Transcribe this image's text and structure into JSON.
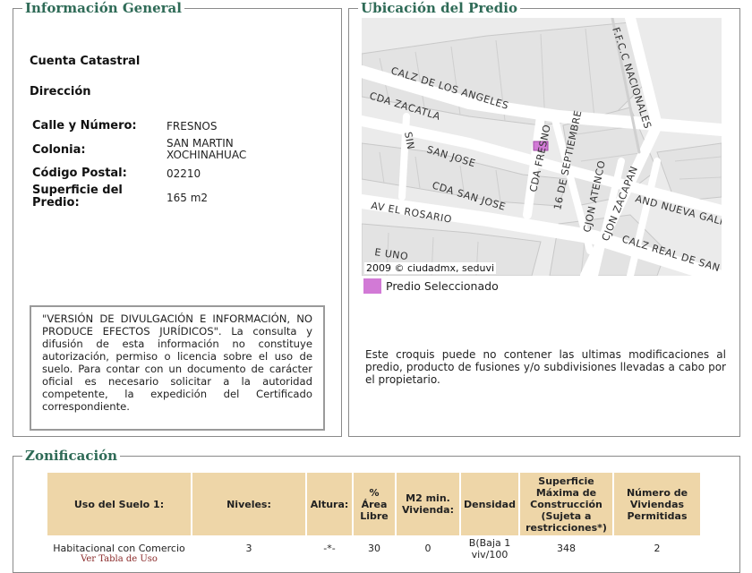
{
  "info": {
    "legend": "Información General",
    "cuenta_label": "Cuenta Catastral",
    "direccion_label": "Dirección",
    "calle_label": "Calle y Número:",
    "calle_value": "FRESNOS",
    "colonia_label": "Colonia:",
    "colonia_value": "SAN MARTIN XOCHINAHUAC",
    "cp_label": "Código Postal:",
    "cp_value": "02210",
    "superficie_label": "Superficie del Predio:",
    "superficie_value": "165 m2",
    "disclaimer": "\"VERSIÓN DE DIVULGACIÓN E INFORMACIÓN, NO PRODUCE EFECTOS JURÍDICOS\". La consulta y difusión de esta información no constituye autorización, permiso o licencia sobre el uso de suelo. Para contar con un documento de carácter oficial es necesario solicitar a la autoridad competente, la expedición del Certificado correspondiente."
  },
  "ubicacion": {
    "legend": "Ubicación del Predio",
    "streets": [
      "F.F.C.C NACIONALES",
      "CALZ DE LOS ANGELES",
      "CDA ZACATLA",
      "SAN JOSE",
      "SIN",
      "CDA FRESNO",
      "16 DE SEPTIEMBRE",
      "CDA SAN JOSE",
      "CJON ATENCO",
      "CJON ZACAPAN",
      "AND NUEVA GALI",
      "AV EL ROSARIO",
      "CALZ REAL DE SAN",
      "E UNO"
    ],
    "copyright": "2009 © ciudadmx, seduvi",
    "legend_label": "Predio Seleccionado",
    "legend_color": "#d27ad6",
    "note": "Este croquis puede no contener las ultimas modificaciones al predio, producto de fusiones y/o subdivisiones llevadas a cabo por el propietario."
  },
  "zonificacion": {
    "legend": "Zonificación",
    "headers": [
      "Uso del Suelo 1:",
      "Niveles:",
      "Altura:",
      "% Área Libre",
      "M2 min. Vivienda:",
      "Densidad",
      "Superficie Máxima de Construcción (Sujeta a restricciones*)",
      "Número de Viviendas Permitidas"
    ],
    "row": {
      "uso": "Habitacional con Comercio",
      "uso_link": "Ver Tabla de Uso",
      "niveles": "3",
      "altura": "-*-",
      "area_libre": "30",
      "m2_min": "0",
      "densidad": "B(Baja 1 viv/100",
      "superficie": "348",
      "viviendas": "2"
    }
  }
}
